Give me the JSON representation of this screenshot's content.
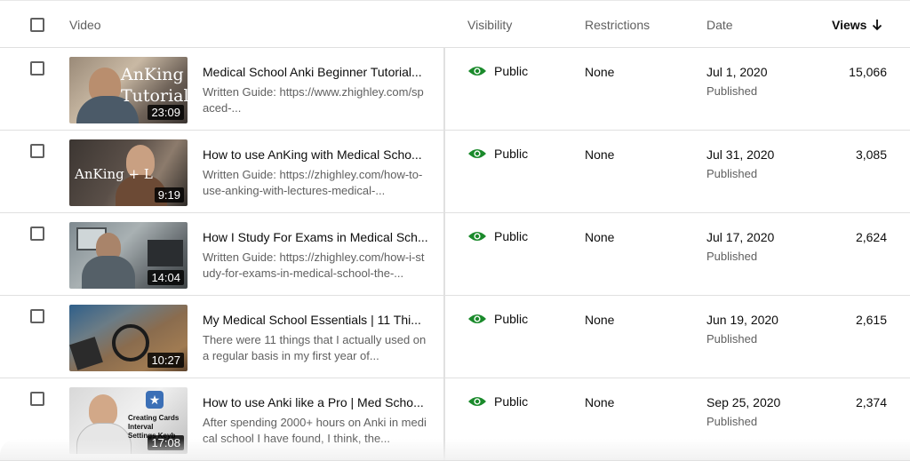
{
  "header": {
    "video": "Video",
    "visibility": "Visibility",
    "restrictions": "Restrictions",
    "date": "Date",
    "views": "Views",
    "sort_icon": "arrow-down-icon"
  },
  "colors": {
    "public_green": "#1a8a2b",
    "text_secondary": "#606060",
    "divider": "#e0e0e0"
  },
  "rows": [
    {
      "title": "Medical School Anki Beginner Tutorial...",
      "description": "Written Guide: https://www.zhighley.com/spaced-...",
      "duration": "23:09",
      "thumb_overlay": "AnKing Tutorial",
      "visibility": "Public",
      "restrictions": "None",
      "date": "Jul 1, 2020",
      "status": "Published",
      "views": "15,066"
    },
    {
      "title": "How to use AnKing with Medical Scho...",
      "description": "Written Guide: https://zhighley.com/how-to-use-anking-with-lectures-medical-...",
      "duration": "9:19",
      "thumb_overlay": "AnKing + L",
      "visibility": "Public",
      "restrictions": "None",
      "date": "Jul 31, 2020",
      "status": "Published",
      "views": "3,085"
    },
    {
      "title": "How I Study For Exams in Medical Sch...",
      "description": "Written Guide: https://zhighley.com/how-i-study-for-exams-in-medical-school-the-...",
      "duration": "14:04",
      "thumb_overlay": "",
      "visibility": "Public",
      "restrictions": "None",
      "date": "Jul 17, 2020",
      "status": "Published",
      "views": "2,624"
    },
    {
      "title": "My Medical School Essentials | 11 Thi...",
      "description": "There were 11 things that I actually used on a regular basis in my first year of...",
      "duration": "10:27",
      "thumb_overlay": "",
      "visibility": "Public",
      "restrictions": "None",
      "date": "Jun 19, 2020",
      "status": "Published",
      "views": "2,615"
    },
    {
      "title": "How to use Anki like a Pro | Med Scho...",
      "description": "After spending 2000+ hours on Anki in medical school I have found, I think, the...",
      "duration": "17:08",
      "thumb_overlay": "Creating Cards Interval Settings Keyb",
      "visibility": "Public",
      "restrictions": "None",
      "date": "Sep 25, 2020",
      "status": "Published",
      "views": "2,374"
    }
  ]
}
